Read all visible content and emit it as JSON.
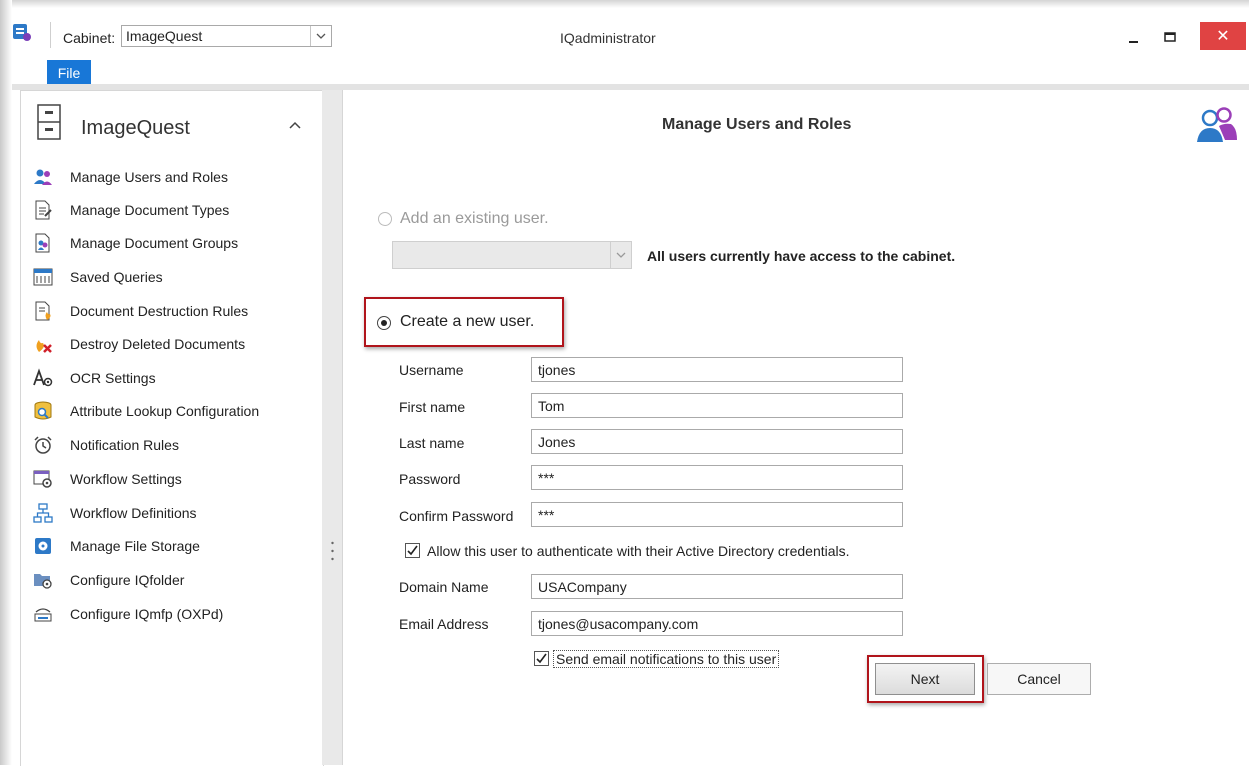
{
  "window": {
    "title": "IQadministrator",
    "cabinet_label": "Cabinet:",
    "cabinet_value": "ImageQuest",
    "close_glyph": "✕"
  },
  "ribbon": {
    "file_tab": "File"
  },
  "sidebar": {
    "title": "ImageQuest",
    "items": [
      {
        "label": "Manage Users and Roles",
        "icon": "users-roles-icon"
      },
      {
        "label": "Manage Document Types",
        "icon": "document-types-icon"
      },
      {
        "label": "Manage Document Groups",
        "icon": "document-groups-icon"
      },
      {
        "label": "Saved Queries",
        "icon": "saved-queries-icon"
      },
      {
        "label": "Document Destruction Rules",
        "icon": "destruction-rules-icon"
      },
      {
        "label": "Destroy Deleted Documents",
        "icon": "destroy-deleted-icon"
      },
      {
        "label": "OCR Settings",
        "icon": "ocr-settings-icon"
      },
      {
        "label": "Attribute Lookup Configuration",
        "icon": "attribute-lookup-icon"
      },
      {
        "label": "Notification Rules",
        "icon": "alarm-clock-icon"
      },
      {
        "label": "Workflow Settings",
        "icon": "workflow-settings-icon"
      },
      {
        "label": "Workflow Definitions",
        "icon": "workflow-definitions-icon"
      },
      {
        "label": "Manage File Storage",
        "icon": "file-storage-icon"
      },
      {
        "label": "Configure IQfolder",
        "icon": "iqfolder-icon"
      },
      {
        "label": "Configure IQmfp (OXPd)",
        "icon": "iqmfp-icon"
      }
    ]
  },
  "main": {
    "title": "Manage Users and Roles",
    "option_existing": "Add an existing user.",
    "existing_note": "All users currently have access to the cabinet.",
    "option_create": "Create a new user.",
    "fields": {
      "username": {
        "label": "Username",
        "value": "tjones"
      },
      "first_name": {
        "label": "First name",
        "value": "Tom"
      },
      "last_name": {
        "label": "Last name",
        "value": "Jones"
      },
      "password": {
        "label": "Password",
        "value": "***"
      },
      "confirm_password": {
        "label": "Confirm Password",
        "value": "***"
      },
      "domain_name": {
        "label": "Domain Name",
        "value": "USACompany"
      },
      "email_address": {
        "label": "Email Address",
        "value": "tjones@usacompany.com"
      }
    },
    "ad_auth_label": "Allow this user to authenticate with their Active Directory credentials.",
    "ad_auth_checked": true,
    "email_notify_label": "Send email notifications to this user",
    "email_notify_checked": true,
    "next_label": "Next",
    "cancel_label": "Cancel"
  },
  "colors": {
    "accent": "#1877d7",
    "highlight": "#b0141b",
    "close": "#e04343"
  }
}
